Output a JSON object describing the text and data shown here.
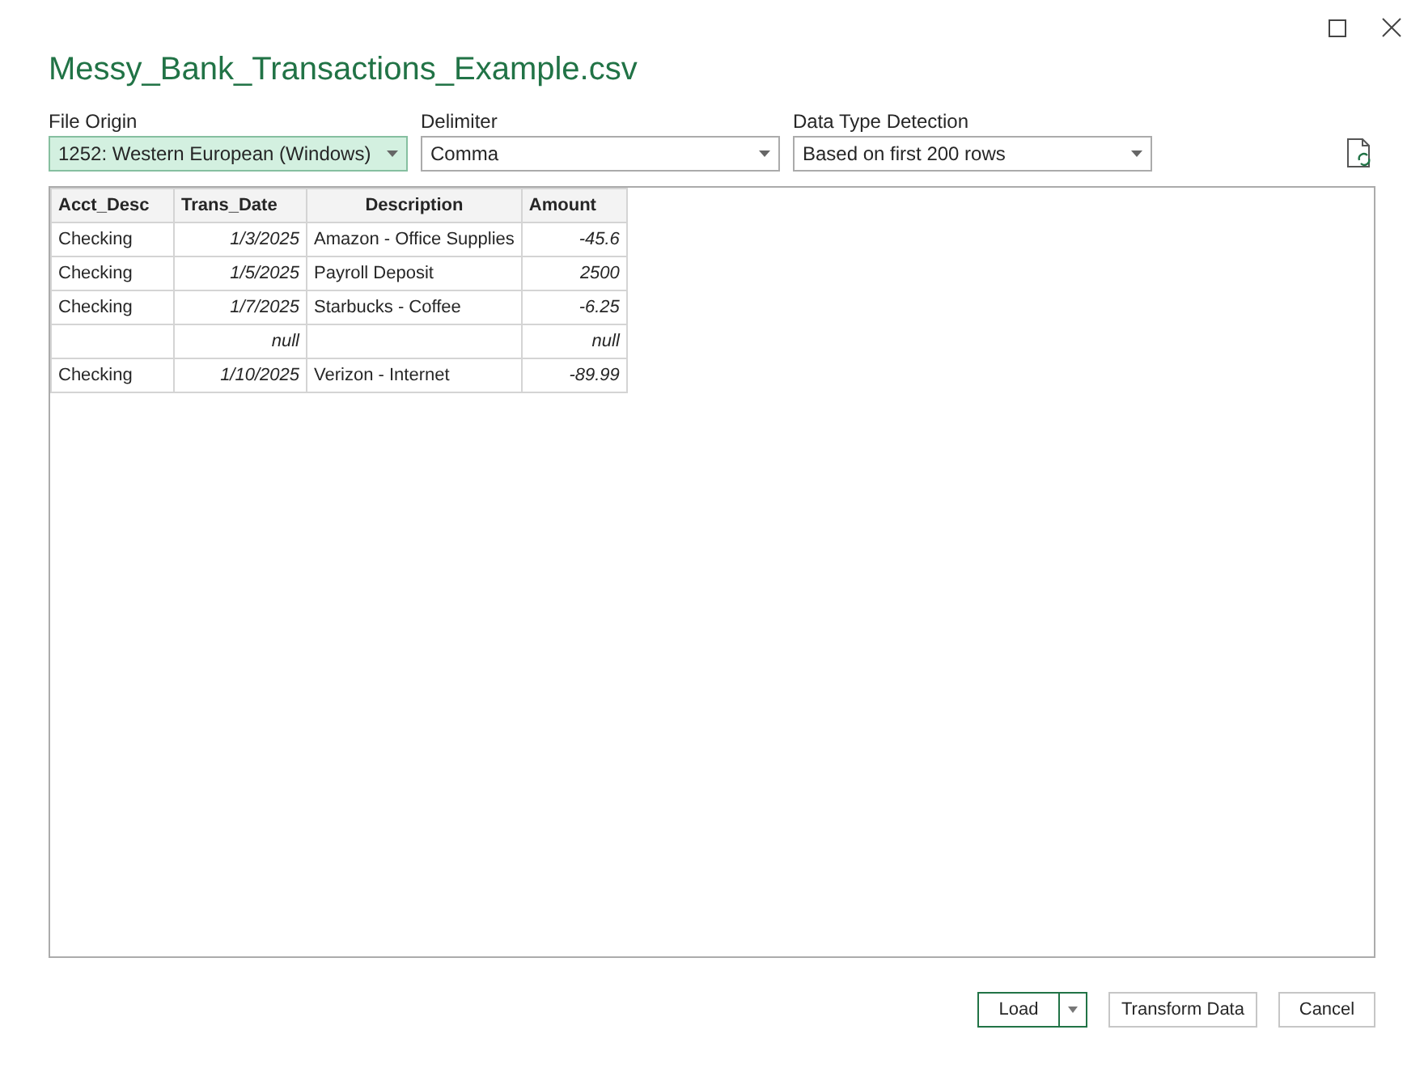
{
  "window": {
    "title": "Messy_Bank_Transactions_Example.csv"
  },
  "options": [
    {
      "label": "File Origin",
      "value": "1252: Western European (Windows)",
      "focused": true
    },
    {
      "label": "Delimiter",
      "value": "Comma",
      "focused": false
    },
    {
      "label": "Data Type Detection",
      "value": "Based on first 200 rows",
      "focused": false
    }
  ],
  "table": {
    "columns": [
      {
        "name": "Acct_Desc",
        "kind": "text"
      },
      {
        "name": "Trans_Date",
        "kind": "value"
      },
      {
        "name": "Description",
        "kind": "text"
      },
      {
        "name": "Amount",
        "kind": "value"
      }
    ],
    "rows": [
      [
        "Checking",
        "1/3/2025",
        "Amazon - Office Supplies",
        "-45.6"
      ],
      [
        "Checking",
        "1/5/2025",
        "Payroll Deposit",
        "2500"
      ],
      [
        "Checking",
        "1/7/2025",
        "Starbucks - Coffee",
        "-6.25"
      ],
      [
        null,
        "null",
        null,
        "null"
      ],
      [
        "Checking",
        "1/10/2025",
        "Verizon - Internet",
        "-89.99"
      ]
    ]
  },
  "buttons": [
    {
      "label": "Load",
      "kind": "primary"
    },
    {
      "label": "Transform Data",
      "kind": "normal"
    },
    {
      "label": "Cancel",
      "kind": "normal"
    }
  ]
}
